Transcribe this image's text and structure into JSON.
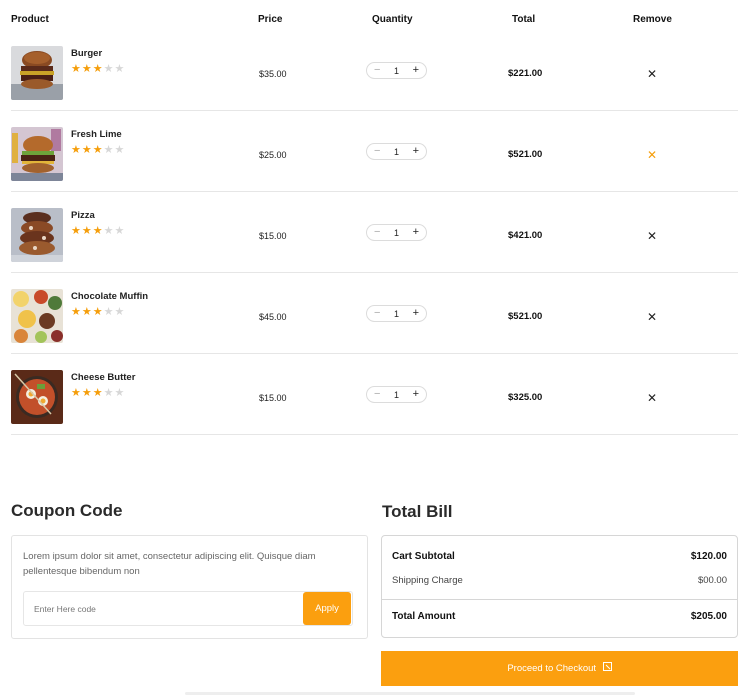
{
  "table": {
    "headers": {
      "product": "Product",
      "price": "Price",
      "quantity": "Quantity",
      "total": "Total",
      "remove": "Remove"
    },
    "rows": [
      {
        "name": "Burger",
        "rating": 3,
        "price": "$35.00",
        "quantity": "1",
        "total": "$221.00",
        "image": "burger-photo"
      },
      {
        "name": "Fresh Lime",
        "rating": 3,
        "price": "$25.00",
        "quantity": "1",
        "total": "$521.00",
        "image": "burger-fries-photo"
      },
      {
        "name": "Pizza",
        "rating": 3,
        "price": "$15.00",
        "quantity": "1",
        "total": "$421.00",
        "image": "stacked-donuts-photo"
      },
      {
        "name": "Chocolate Muffin",
        "rating": 3,
        "price": "$45.00",
        "quantity": "1",
        "total": "$521.00",
        "image": "food-spread-photo"
      },
      {
        "name": "Cheese Butter",
        "rating": 3,
        "price": "$15.00",
        "quantity": "1",
        "total": "$325.00",
        "image": "ramen-bowl-photo"
      }
    ],
    "rating_max": 5,
    "quantity_controls": {
      "minus": "−",
      "plus": "+"
    },
    "remove_icon": "close-icon"
  },
  "coupon": {
    "title": "Coupon Code",
    "description": "Lorem ipsum dolor sit amet, consectetur adipiscing elit. Quisque diam pellentesque bibendum non",
    "input_value": "",
    "input_placeholder": "Enter Here code",
    "apply_label": "Apply"
  },
  "bill": {
    "title": "Total Bill",
    "subtotal_label": "Cart Subtotal",
    "subtotal_value": "$120.00",
    "shipping_label": "Shipping Charge",
    "shipping_value": "$00.00",
    "total_label": "Total Amount",
    "total_value": "$205.00"
  },
  "checkout": {
    "label": "Proceed to Checkout",
    "icon": "checkout-icon"
  },
  "colors": {
    "accent": "#fb9f0f",
    "star": "#f59e0b",
    "star_empty": "#d7d7d7",
    "remove_active": "#f59e0b"
  }
}
